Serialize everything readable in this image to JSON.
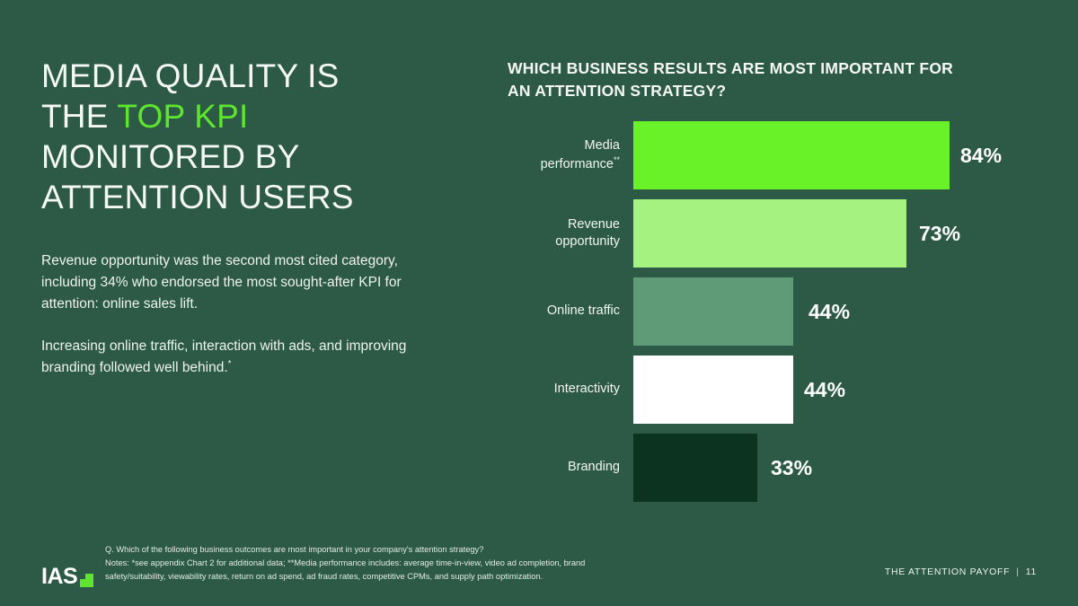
{
  "theme": {
    "background": "#2c5a46",
    "accent_green": "#5ee62e",
    "text_light": "#ffffff"
  },
  "headline": {
    "line1": "MEDIA QUALITY IS",
    "line2_prefix": "THE ",
    "line2_accent": "TOP KPI",
    "line3": "MONITORED BY",
    "line4": "ATTENTION USERS"
  },
  "body": {
    "paragraph1": "Revenue opportunity was the second most cited category, including 34% who endorsed the most sought-after KPI for attention: online sales lift.",
    "paragraph2": "Increasing online traffic, interaction with ads, and improving branding followed well behind.",
    "paragraph2_superscript": "*"
  },
  "chart_title": "WHICH BUSINESS RESULTS ARE MOST IMPORTANT FOR AN ATTENTION STRATEGY?",
  "chart_data": {
    "type": "bar",
    "orientation": "horizontal",
    "title": "WHICH BUSINESS RESULTS ARE MOST IMPORTANT FOR AN ATTENTION STRATEGY?",
    "xlabel": "",
    "ylabel": "",
    "xlim": [
      0,
      100
    ],
    "grid": false,
    "legend": false,
    "categories": [
      "Media performance**",
      "Revenue opportunity",
      "Online traffic",
      "Interactivity",
      "Branding"
    ],
    "values": [
      84,
      73,
      44,
      44,
      33
    ],
    "value_labels": [
      "84%",
      "73%",
      "44%",
      "44%",
      "33%"
    ],
    "bar_colors": [
      "#68f227",
      "#a5f280",
      "#5f9b76",
      "#ffffff",
      "#0c3320"
    ],
    "bars": [
      {
        "label_line1": "Media",
        "label_line2": "performance",
        "label_superscript": "**",
        "value": 84,
        "value_label": "84%",
        "color": "#68f227"
      },
      {
        "label_line1": "Revenue",
        "label_line2": "opportunity",
        "label_superscript": "",
        "value": 73,
        "value_label": "73%",
        "color": "#a5f280"
      },
      {
        "label_line1": "Online traffic",
        "label_line2": "",
        "label_superscript": "",
        "value": 44,
        "value_label": "44%",
        "color": "#5f9b76"
      },
      {
        "label_line1": "Interactivity",
        "label_line2": "",
        "label_superscript": "",
        "value": 44,
        "value_label": "44%",
        "color": "#ffffff"
      },
      {
        "label_line1": "Branding",
        "label_line2": "",
        "label_superscript": "",
        "value": 33,
        "value_label": "33%",
        "color": "#0c3320"
      }
    ]
  },
  "footnotes": {
    "question": "Q. Which of the following business outcomes are most important in your company's attention strategy?",
    "notes_line1": "Notes: *see appendix Chart 2 for additional data; **Media performance includes: average time-in-view, video ad completion, brand",
    "notes_line2": "safety/suitability, viewability rates, return on ad spend, ad fraud rates, competitive CPMs, and supply path optimization."
  },
  "footer": {
    "logo_text": "IAS",
    "deck_title": "THE ATTENTION PAYOFF",
    "separator": "|",
    "page_number": "11"
  }
}
